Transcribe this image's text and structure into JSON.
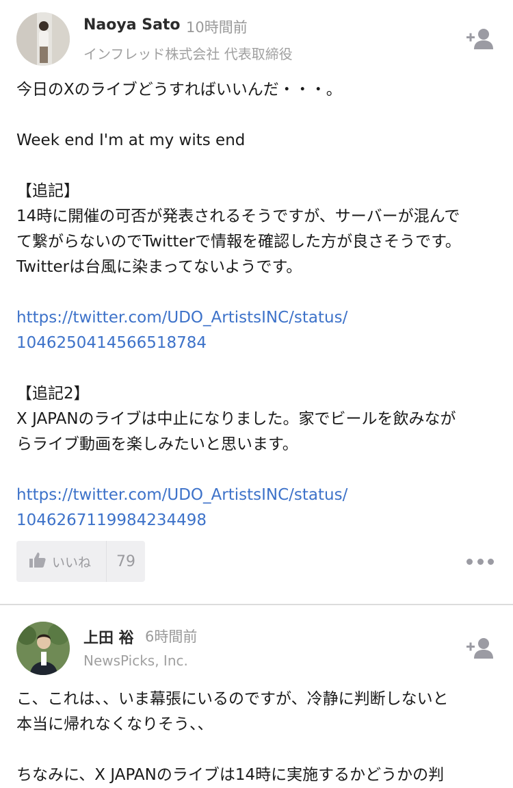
{
  "comments": [
    {
      "author": "Naoya Sato",
      "time": "10時間前",
      "org": "インフレッド株式会社 代表取締役",
      "lines": [
        {
          "text": "今日のXのライブどうすればいいんだ・・・。",
          "type": "text"
        },
        {
          "text": "",
          "type": "blank"
        },
        {
          "text": "Week end I'm at my wits end",
          "type": "text"
        },
        {
          "text": "",
          "type": "blank"
        },
        {
          "text": "【追記】",
          "type": "text"
        },
        {
          "text": "14時に開催の可否が発表されるそうですが、サーバーが混んで",
          "type": "text"
        },
        {
          "text": "て繋がらないのでTwitterで情報を確認した方が良さそうです。",
          "type": "text"
        },
        {
          "text": "Twitterは台風に染まってないようです。",
          "type": "text"
        },
        {
          "text": "",
          "type": "blank"
        },
        {
          "text": "https://twitter.com/UDO_ArtistsINC/status/",
          "type": "link"
        },
        {
          "text": "1046250414566518784",
          "type": "link"
        },
        {
          "text": "",
          "type": "blank"
        },
        {
          "text": "【追記2】",
          "type": "text"
        },
        {
          "text": "X JAPANのライブは中止になりました。家でビールを飲みなが",
          "type": "text"
        },
        {
          "text": "らライブ動画を楽しみたいと思います。",
          "type": "text"
        },
        {
          "text": "",
          "type": "blank"
        },
        {
          "text": "https://twitter.com/UDO_ArtistsINC/status/",
          "type": "link"
        },
        {
          "text": "1046267119984234498",
          "type": "link"
        }
      ],
      "like_label": "いいね",
      "like_count": "79"
    },
    {
      "author": "上田 裕",
      "time": "6時間前",
      "org": "NewsPicks, Inc.",
      "lines": [
        {
          "text": "こ、これは、、いま幕張にいるのですが、冷静に判断しないと",
          "type": "text"
        },
        {
          "text": "本当に帰れなくなりそう、、",
          "type": "text"
        },
        {
          "text": "",
          "type": "blank"
        },
        {
          "text": "ちなみに、X JAPANのライブは14時に実施するかどうかの判",
          "type": "text"
        }
      ]
    }
  ],
  "icons": {
    "follow": "add-user-icon",
    "like": "thumbs-up-icon",
    "more": "more-dots-icon"
  },
  "colors": {
    "link": "#3d72c9",
    "muted": "#999999",
    "like_bg": "#efeff1"
  }
}
